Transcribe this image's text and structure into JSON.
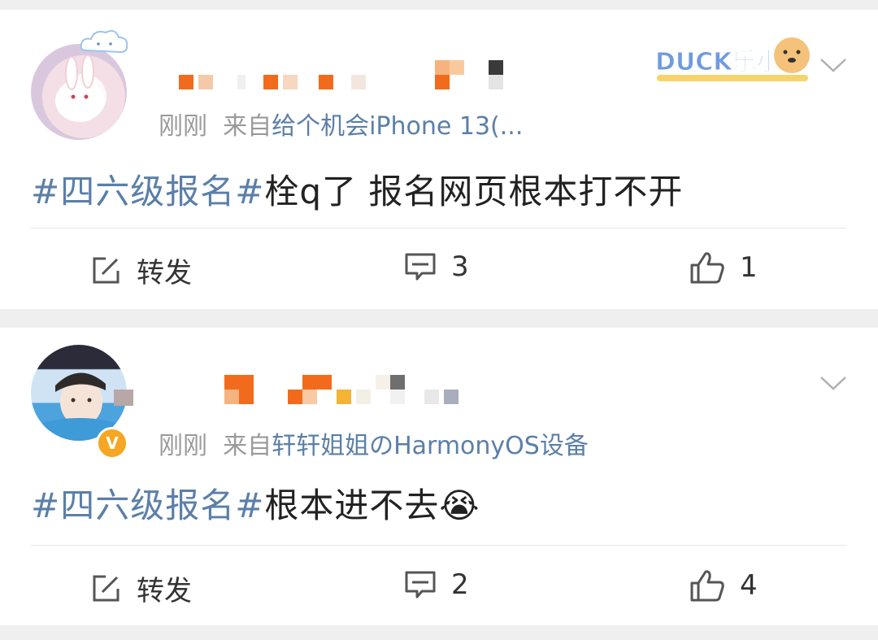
{
  "posts": [
    {
      "time": "刚刚",
      "source_prefix": "来自",
      "source": "给个机会iPhone 13(...",
      "hashtag": "#四六级报名#",
      "text": "栓q了  报名网页根本打不开",
      "repost_label": "转发",
      "comment_count": "3",
      "like_count": "1",
      "badge_text": "DUCK乐小"
    },
    {
      "time": "刚刚",
      "source_prefix": "来自",
      "source": "轩轩姐姐のHarmonyOS设备",
      "hashtag": "#四六级报名#",
      "text": "根本进不去",
      "emoji": "😭",
      "repost_label": "转发",
      "comment_count": "2",
      "like_count": "4",
      "verified_mark": "V"
    }
  ],
  "colors": {
    "accent": "#5b7fa8",
    "meta_gray": "#9a9a9a",
    "background": "#efefef",
    "mosaic_orange": "#f26b1d",
    "mosaic_light": "#f5c9a8",
    "verified": "#f5a623"
  },
  "icons": [
    "repost-icon",
    "comment-icon",
    "like-icon",
    "chevron-down-icon"
  ]
}
